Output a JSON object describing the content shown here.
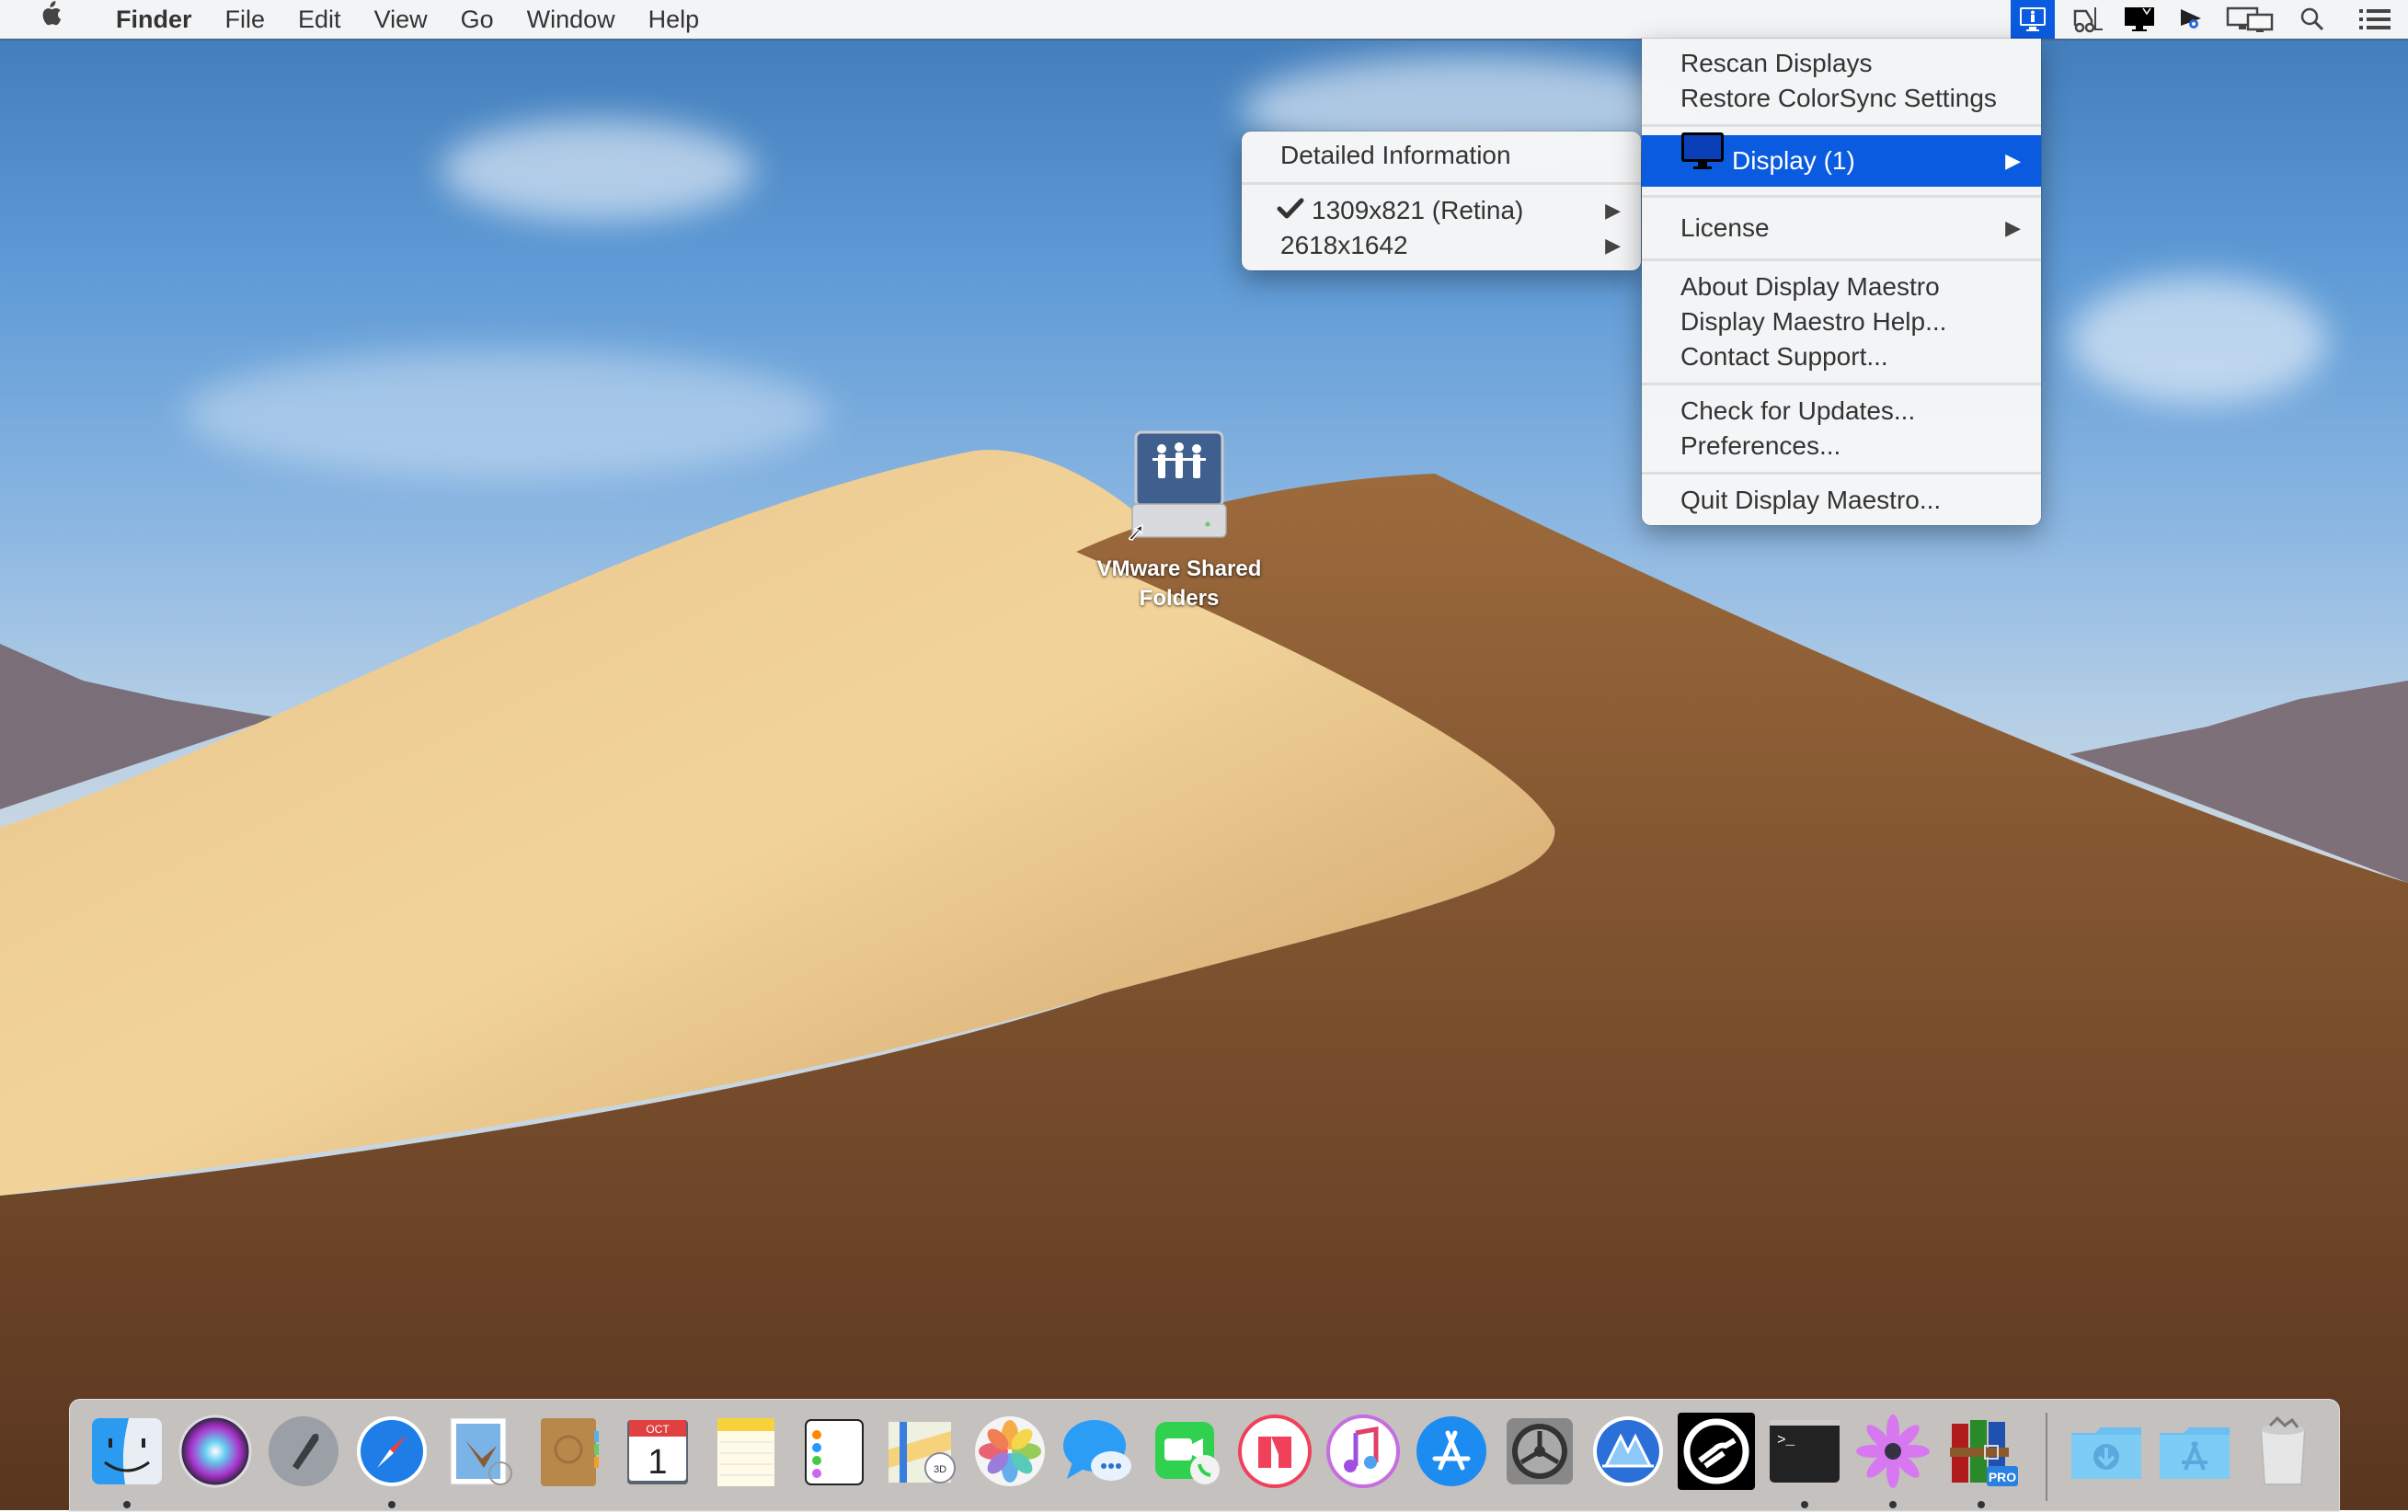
{
  "menubar": {
    "apple_icon": "apple-logo-icon",
    "app_name": "Finder",
    "menus": [
      "File",
      "Edit",
      "View",
      "Go",
      "Window",
      "Help"
    ],
    "status_icons": [
      {
        "name": "display-maestro-icon",
        "active": true
      },
      {
        "name": "forklift-icon",
        "active": false
      },
      {
        "name": "display-menu-icon",
        "active": false
      },
      {
        "name": "cursor-recorder-icon",
        "active": false
      },
      {
        "name": "screens-icon",
        "active": false
      },
      {
        "name": "spotlight-search-icon",
        "active": false
      },
      {
        "name": "notification-center-icon",
        "active": false
      }
    ]
  },
  "main_menu": {
    "items": [
      {
        "label": "Rescan Displays"
      },
      {
        "label": "Restore ColorSync Settings"
      },
      {
        "label": "Display (1)",
        "submenu": true,
        "highlighted": true,
        "icon": "monitor-icon"
      },
      {
        "label": "License",
        "submenu": true
      },
      {
        "label": "About Display Maestro"
      },
      {
        "label": "Display Maestro Help..."
      },
      {
        "label": "Contact Support..."
      },
      {
        "label": "Check for Updates..."
      },
      {
        "label": "Preferences..."
      },
      {
        "label": "Quit Display Maestro..."
      }
    ]
  },
  "submenu": {
    "items": [
      {
        "label": "Detailed Information"
      },
      {
        "label": "1309x821 (Retina)",
        "checked": true,
        "submenu": true
      },
      {
        "label": "2618x1642",
        "submenu": true
      }
    ]
  },
  "desktop": {
    "icon_label_line1": "VMware Shared",
    "icon_label_line2": "Folders"
  },
  "dock": {
    "apps": [
      {
        "name": "Finder",
        "running": true
      },
      {
        "name": "Siri",
        "running": false
      },
      {
        "name": "Launchpad",
        "running": false
      },
      {
        "name": "Safari",
        "running": true
      },
      {
        "name": "Mail",
        "running": false
      },
      {
        "name": "Contacts",
        "running": false
      },
      {
        "name": "Calendar",
        "running": false,
        "month": "OCT",
        "day": "1"
      },
      {
        "name": "Notes",
        "running": false
      },
      {
        "name": "Reminders",
        "running": false
      },
      {
        "name": "Maps",
        "running": false
      },
      {
        "name": "Photos",
        "running": false
      },
      {
        "name": "Messages",
        "running": false
      },
      {
        "name": "FaceTime",
        "running": false
      },
      {
        "name": "News",
        "running": false
      },
      {
        "name": "iTunes",
        "running": false
      },
      {
        "name": "App Store",
        "running": false
      },
      {
        "name": "System Preferences",
        "running": false
      },
      {
        "name": "Display Maestro",
        "running": false
      },
      {
        "name": "Tuxera",
        "running": false
      },
      {
        "name": "Terminal",
        "running": true
      },
      {
        "name": "Flower App",
        "running": true
      },
      {
        "name": "RAR Extractor Pro",
        "running": true,
        "badge": "PRO"
      }
    ],
    "stacks": [
      {
        "name": "Downloads"
      },
      {
        "name": "Applications"
      },
      {
        "name": "Trash"
      }
    ]
  }
}
